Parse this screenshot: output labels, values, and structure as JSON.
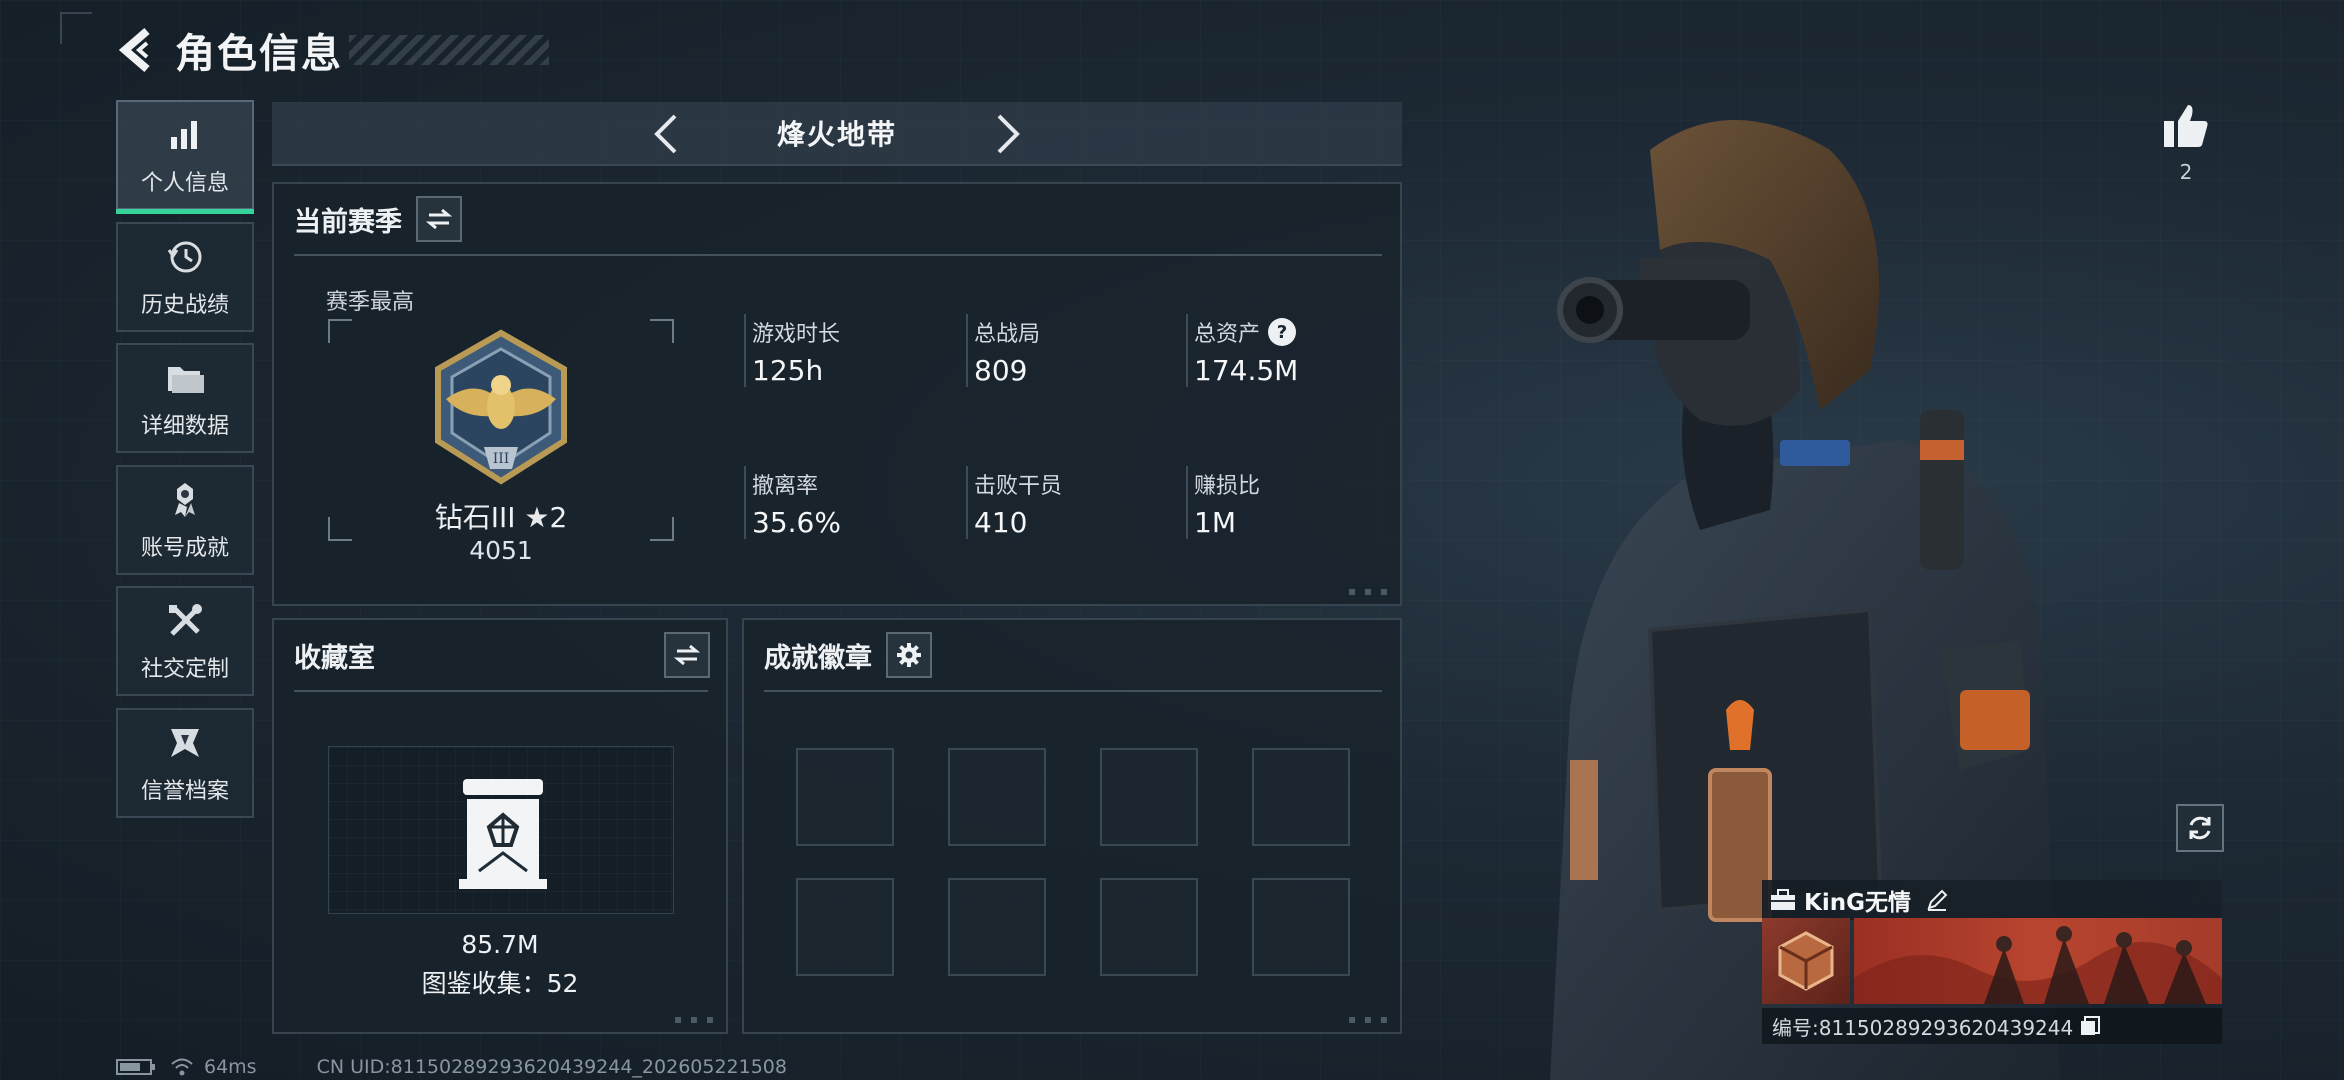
{
  "header": {
    "title": "角色信息"
  },
  "sidebar": {
    "items": [
      {
        "label": "个人信息",
        "icon": "bar-chart-icon",
        "active": true
      },
      {
        "label": "历史战绩",
        "icon": "history-clock-icon",
        "active": false
      },
      {
        "label": "详细数据",
        "icon": "folder-icon",
        "active": false
      },
      {
        "label": "账号成就",
        "icon": "achievement-icon",
        "active": false
      },
      {
        "label": "社交定制",
        "icon": "tools-icon",
        "active": false
      },
      {
        "label": "信誉档案",
        "icon": "reputation-icon",
        "active": false
      }
    ]
  },
  "map_selector": {
    "title": "烽火地带"
  },
  "season": {
    "title": "当前赛季",
    "subtitle": "赛季最高",
    "rank_name": "钻石III",
    "rank_stars": "2",
    "rank_score": "4051",
    "stats": [
      {
        "label": "游戏时长",
        "value": "125h"
      },
      {
        "label": "总战局",
        "value": "809"
      },
      {
        "label": "总资产",
        "value": "174.5M",
        "help": "?"
      },
      {
        "label": "撤离率",
        "value": "35.6%"
      },
      {
        "label": "击败干员",
        "value": "410"
      },
      {
        "label": "赚损比",
        "value": "1M"
      }
    ]
  },
  "collection": {
    "title": "收藏室",
    "value": "85.7M",
    "catalog": "图鉴收集：52"
  },
  "achievements": {
    "title": "成就徽章",
    "slots": 8
  },
  "profile": {
    "likes": "2",
    "player_name": "KinG无情",
    "uid": "编号:8115028929362043924​4"
  },
  "footer": {
    "ping": "64ms",
    "cn_uid": "CN UID:81150289293620439244_202605221508"
  },
  "colors": {
    "accent": "#34d49a",
    "background": "#1a2530",
    "panel_border": "#37444f"
  }
}
